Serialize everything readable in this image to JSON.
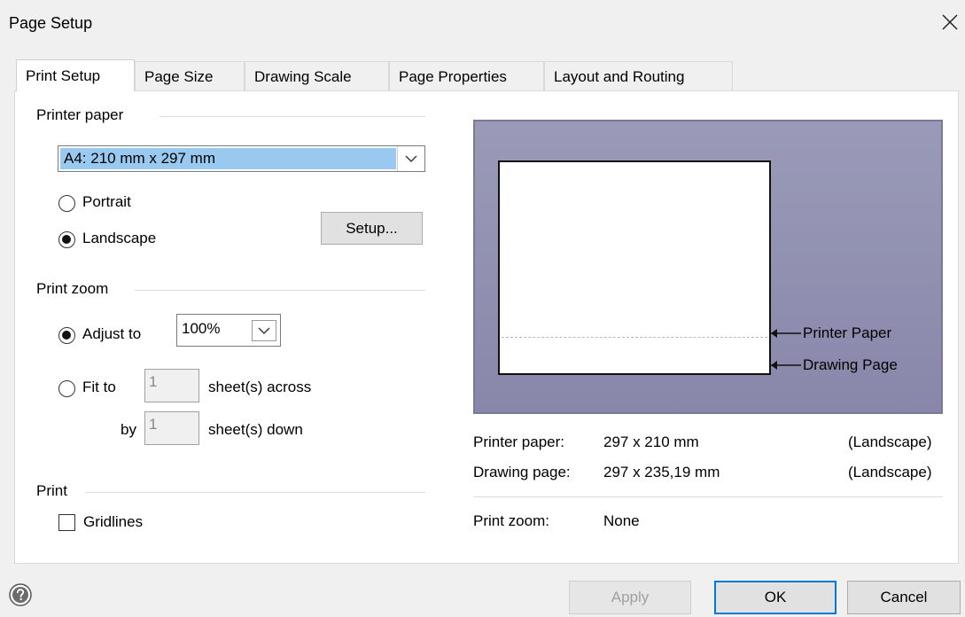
{
  "dialog": {
    "title": "Page Setup"
  },
  "tabs": [
    {
      "label": "Print Setup",
      "active": true
    },
    {
      "label": "Page Size",
      "active": false
    },
    {
      "label": "Drawing Scale",
      "active": false
    },
    {
      "label": "Page Properties",
      "active": false
    },
    {
      "label": "Layout and Routing",
      "active": false
    }
  ],
  "printer_paper": {
    "group_label": "Printer paper",
    "selected_size": "A4:  210 mm x 297 mm",
    "portrait_label": "Portrait",
    "landscape_label": "Landscape",
    "orientation": "Landscape",
    "setup_button": "Setup..."
  },
  "print_zoom": {
    "group_label": "Print zoom",
    "adjust_label": "Adjust to",
    "adjust_value": "100%",
    "fit_label": "Fit to",
    "fit_across_value": "1",
    "across_label": "sheet(s) across",
    "by_label": "by",
    "fit_down_value": "1",
    "down_label": "sheet(s) down",
    "selected": "Adjust to"
  },
  "print": {
    "group_label": "Print",
    "gridlines_label": "Gridlines",
    "gridlines_checked": false
  },
  "preview": {
    "printer_paper_label": "Printer Paper",
    "drawing_page_label": "Drawing Page"
  },
  "info": {
    "printer_paper_key": "Printer paper:",
    "printer_paper_value": "297 x 210 mm",
    "printer_paper_orientation": "(Landscape)",
    "drawing_page_key": "Drawing page:",
    "drawing_page_value": "297 x 235,19 mm",
    "drawing_page_orientation": "(Landscape)",
    "print_zoom_key": "Print zoom:",
    "print_zoom_value": "None"
  },
  "footer": {
    "apply_label": "Apply",
    "ok_label": "OK",
    "cancel_label": "Cancel",
    "help_icon": "help-icon"
  },
  "colors": {
    "selection": "#99c9ef",
    "preview_background": "#8b8aac",
    "default_button_border": "#0078d7"
  }
}
